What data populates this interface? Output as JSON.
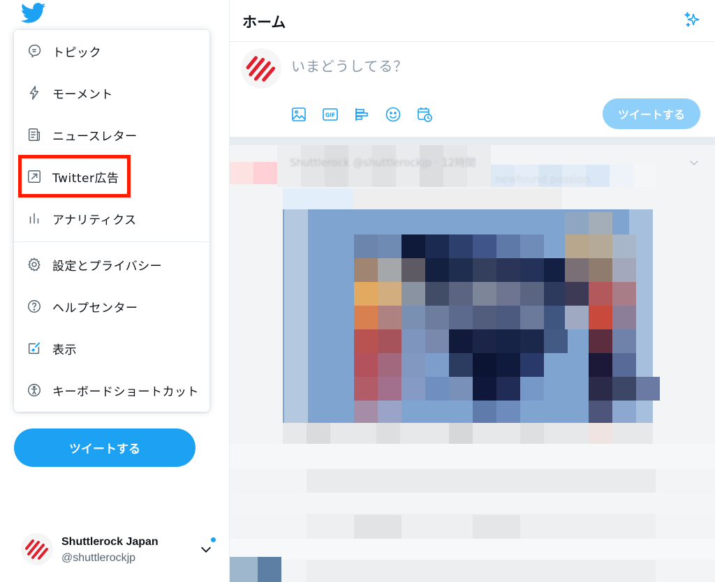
{
  "menu": {
    "items": [
      {
        "label": "トピック",
        "icon": "topics-icon"
      },
      {
        "label": "モーメント",
        "icon": "moments-icon"
      },
      {
        "label": "ニュースレター",
        "icon": "newsletters-icon"
      },
      {
        "label": "Twitter広告",
        "icon": "ads-arrow-icon"
      },
      {
        "label": "アナリティクス",
        "icon": "analytics-icon"
      },
      {
        "label": "設定とプライバシー",
        "icon": "settings-gear-icon"
      },
      {
        "label": "ヘルプセンター",
        "icon": "help-icon"
      },
      {
        "label": "表示",
        "icon": "display-icon"
      },
      {
        "label": "キーボードショートカット",
        "icon": "accessibility-icon"
      }
    ]
  },
  "sidebar": {
    "tweet_button": "ツイートする"
  },
  "account": {
    "name": "Shuttlerock Japan",
    "handle": "@shuttlerockjp"
  },
  "header": {
    "title": "ホーム"
  },
  "composer": {
    "placeholder": "いまどうしてる？",
    "tweet_button": "ツイートする",
    "tools": [
      "image-icon",
      "gif-icon",
      "poll-icon",
      "emoji-icon",
      "schedule-icon"
    ]
  },
  "feed": {
    "blurred_header": "Shuttlerock @shuttlerockjp · 12時間",
    "blurred_text": "newfound passion"
  },
  "colors": {
    "accent": "#1da1f2",
    "accent_disabled": "#8ed0f9",
    "highlight": "#ff1a00",
    "brand_red": "#e0202e"
  }
}
